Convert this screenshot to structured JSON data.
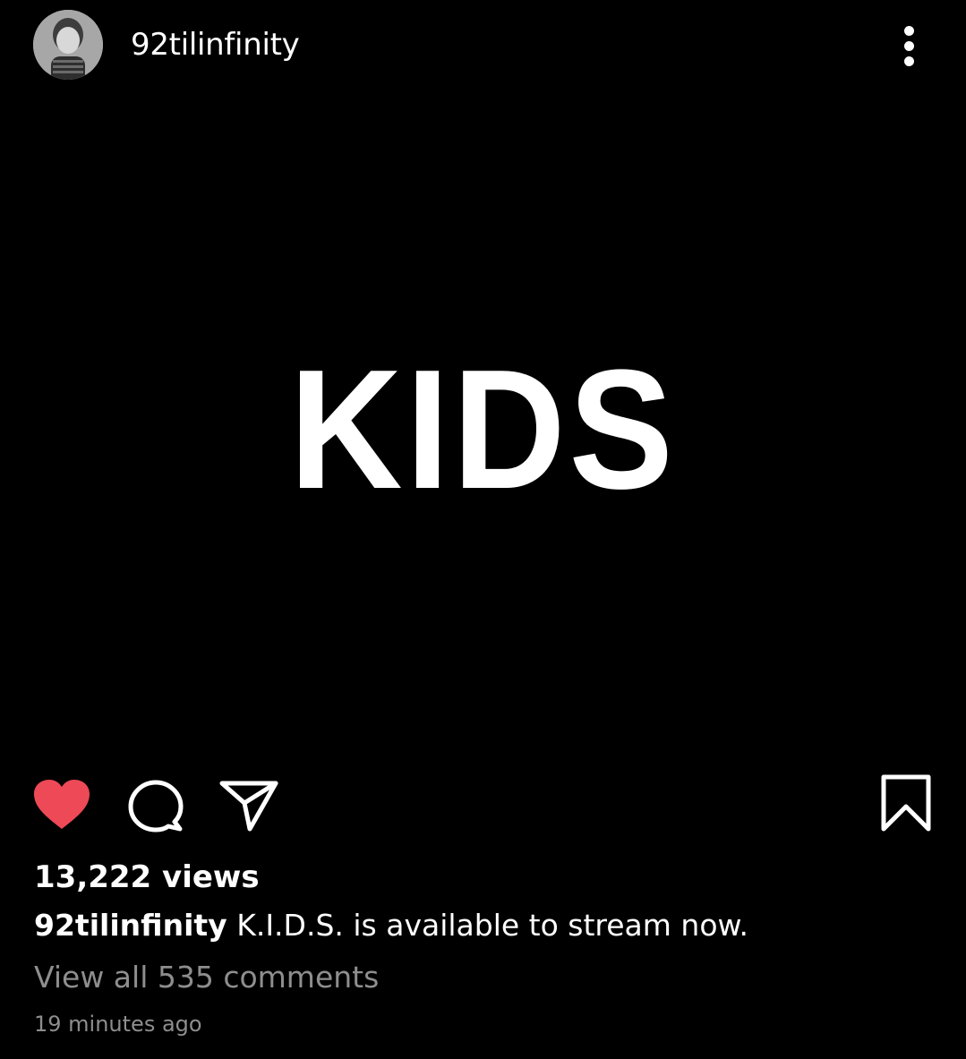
{
  "post": {
    "username": "92tilinfinity",
    "image_text": "KIDS",
    "views": "13,222 views",
    "caption_user": "92tilinfinity",
    "caption_text": "K.I.D.S. is available to stream now.",
    "view_comments": "View all 535 comments",
    "timestamp": "19 minutes ago"
  },
  "icons": {
    "like": "heart-icon",
    "comment": "comment-icon",
    "share": "send-icon",
    "save": "bookmark-icon",
    "more": "more-vertical-icon"
  },
  "colors": {
    "background": "#000000",
    "like_active": "#ed4956",
    "text_primary": "#ffffff",
    "text_secondary": "#8e8e8e"
  },
  "state": {
    "liked": true
  }
}
